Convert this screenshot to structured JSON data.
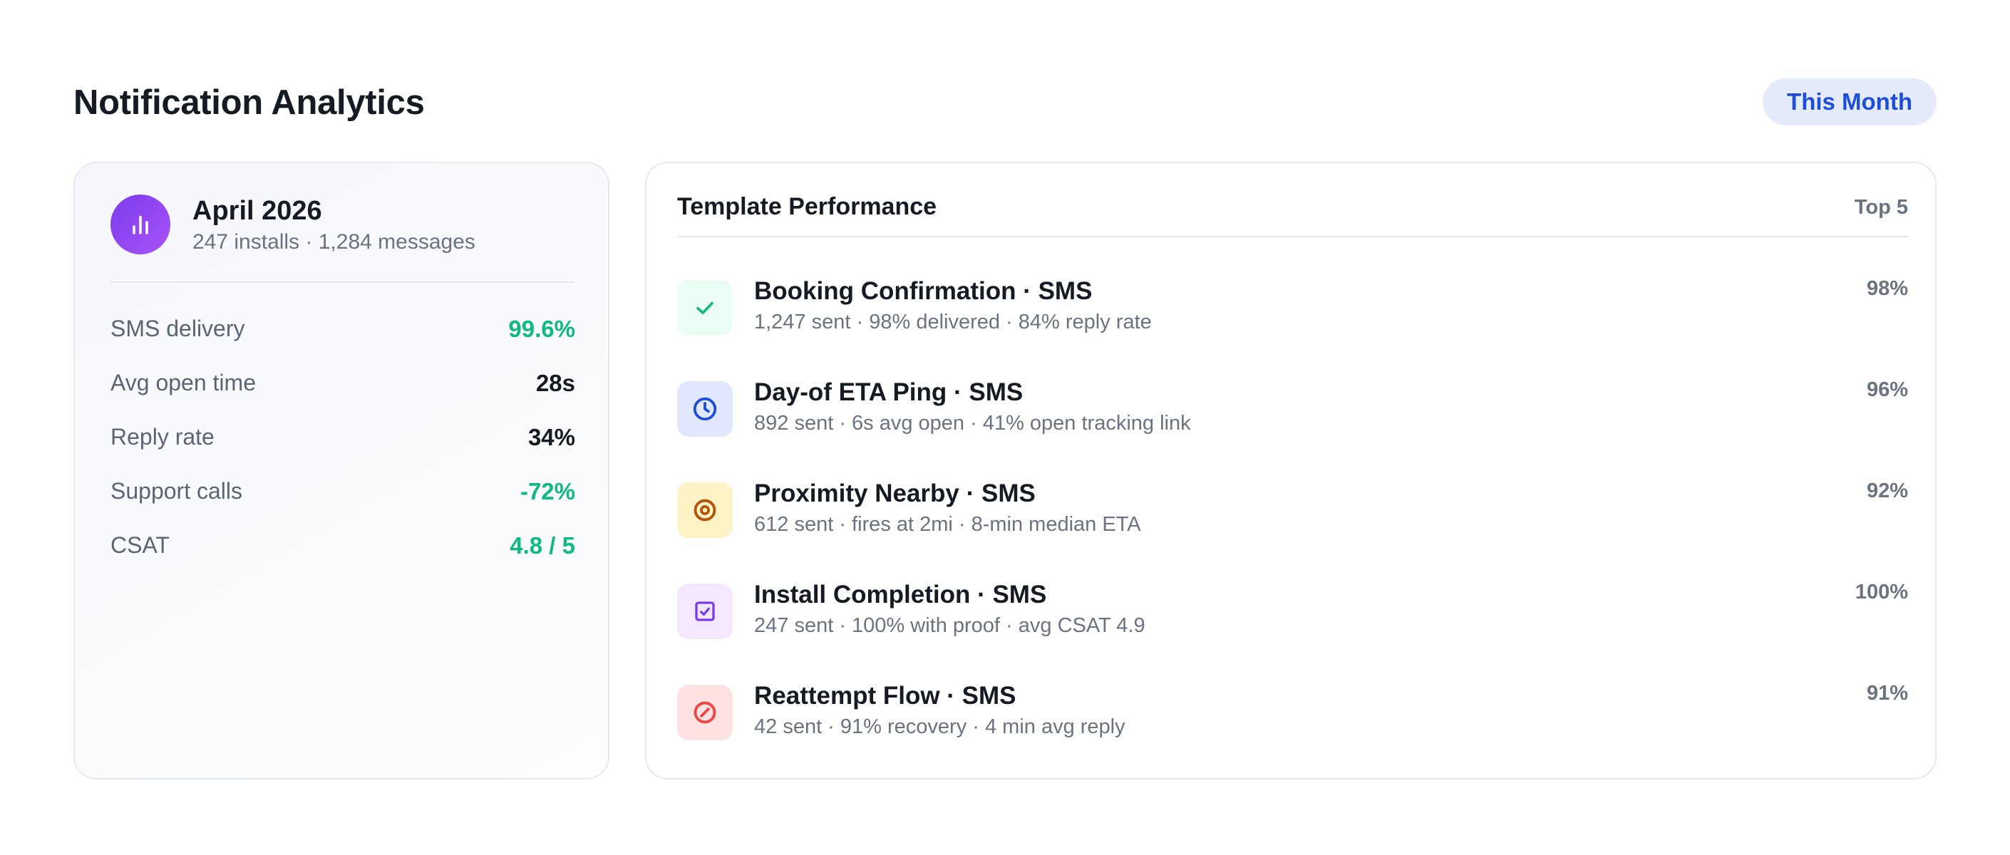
{
  "header": {
    "title": "Notification Analytics",
    "period": "This Month"
  },
  "summary": {
    "icon": "bar-chart-icon",
    "title": "April 2026",
    "subtitle": "247 installs · 1,284 messages",
    "metrics": [
      {
        "label": "SMS delivery",
        "value": "99.6%",
        "color": "#10b981"
      },
      {
        "label": "Avg open time",
        "value": "28s",
        "color": "#151a23"
      },
      {
        "label": "Reply rate",
        "value": "34%",
        "color": "#151a23"
      },
      {
        "label": "Support calls",
        "value": "-72%",
        "color": "#10b981"
      },
      {
        "label": "CSAT",
        "value": "4.8 / 5",
        "color": "#10b981"
      }
    ]
  },
  "templates": {
    "title": "Template Performance",
    "count_label": "Top 5",
    "items": [
      {
        "icon": "check-icon",
        "name": "Booking Confirmation · SMS",
        "desc": "1,247 sent · 98% delivered · 84% reply rate",
        "pct": "98%",
        "icon_color": "#10b981",
        "icon_bg": "#ecfdf5"
      },
      {
        "icon": "clock-icon",
        "name": "Day-of ETA Ping · SMS",
        "desc": "892 sent · 6s avg open · 41% open tracking link",
        "pct": "96%",
        "icon_color": "#1d4ed8",
        "icon_bg": "#e0e7ff"
      },
      {
        "icon": "target-icon",
        "name": "Proximity Nearby · SMS",
        "desc": "612 sent · fires at 2mi · 8-min median ETA",
        "pct": "92%",
        "icon_color": "#b45309",
        "icon_bg": "#fef3c7"
      },
      {
        "icon": "checkbox-icon",
        "name": "Install Completion · SMS",
        "desc": "247 sent · 100% with proof · avg CSAT 4.9",
        "pct": "100%",
        "icon_color": "#7c3aed",
        "icon_bg": "#f3e8ff"
      },
      {
        "icon": "compass-icon",
        "name": "Reattempt Flow · SMS",
        "desc": "42 sent · 91% recovery · 4 min avg reply",
        "pct": "91%",
        "icon_color": "#ef4444",
        "icon_bg": "#fee2e2"
      }
    ]
  }
}
